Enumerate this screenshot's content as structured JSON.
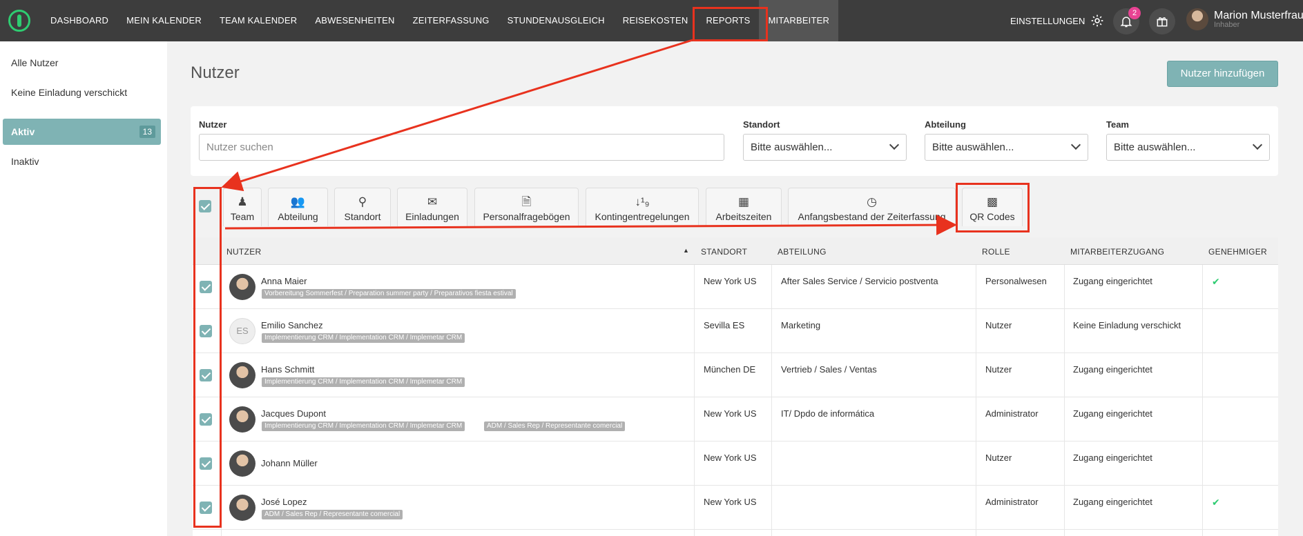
{
  "nav": {
    "items": [
      "DASHBOARD",
      "MEIN KALENDER",
      "TEAM KALENDER",
      "ABWESENHEITEN",
      "ZEITERFASSUNG",
      "STUNDENAUSGLEICH",
      "REISEKOSTEN",
      "REPORTS",
      "MITARBEITER"
    ],
    "settings_label": "EINSTELLUNGEN",
    "notification_count": "2",
    "user_name": "Marion Musterfrau",
    "user_role": "Inhaber"
  },
  "sidebar": {
    "items": [
      {
        "label": "Alle Nutzer"
      },
      {
        "label": "Keine Einladung verschickt"
      },
      {
        "label": "Aktiv",
        "count": "13"
      },
      {
        "label": "Inaktiv"
      }
    ]
  },
  "page": {
    "title": "Nutzer",
    "add_button": "Nutzer hinzufügen"
  },
  "filters": {
    "user_label": "Nutzer",
    "user_placeholder": "Nutzer suchen",
    "location_label": "Standort",
    "department_label": "Abteilung",
    "team_label": "Team",
    "select_value": "Bitte auswählen..."
  },
  "toolbar": {
    "tabs": [
      "Team",
      "Abteilung",
      "Standort",
      "Einladungen",
      "Personalfragebögen",
      "Kontingentregelungen",
      "Arbeitszeiten",
      "Anfangsbestand der Zeiterfassung",
      "QR Codes"
    ]
  },
  "table": {
    "headers": [
      "NUTZER",
      "STANDORT",
      "ABTEILUNG",
      "ROLLE",
      "MITARBEITERZUGANG",
      "GENEHMIGER"
    ],
    "rows": [
      {
        "name": "Anna Maier",
        "tags": [
          "Vorbereitung Sommerfest / Preparation summer party / Preparativos fiesta estival"
        ],
        "location": "New York US",
        "department": "After Sales Service / Servicio postventa",
        "role": "Personalwesen",
        "access": "Zugang eingerichtet",
        "approver": "✔"
      },
      {
        "name": "Emilio Sanchez",
        "initials": "ES",
        "tags": [
          "Implementierung CRM / Implementation CRM / Implemetar CRM"
        ],
        "location": "Sevilla ES",
        "department": "Marketing",
        "role": "Nutzer",
        "access": "Keine Einladung verschickt",
        "approver": ""
      },
      {
        "name": "Hans Schmitt",
        "tags": [
          "Implementierung CRM / Implementation CRM / Implemetar CRM"
        ],
        "location": "München DE",
        "department": "Vertrieb / Sales / Ventas",
        "role": "Nutzer",
        "access": "Zugang eingerichtet",
        "approver": ""
      },
      {
        "name": "Jacques Dupont",
        "tags": [
          "Implementierung CRM / Implementation CRM / Implemetar CRM",
          "ADM / Sales Rep / Representante comercial"
        ],
        "location": "New York US",
        "department": "IT/ Dpdo de informática",
        "role": "Administrator",
        "access": "Zugang eingerichtet",
        "approver": ""
      },
      {
        "name": "Johann Müller",
        "tags": [],
        "location": "New York US",
        "department": "",
        "role": "Nutzer",
        "access": "Zugang eingerichtet",
        "approver": ""
      },
      {
        "name": "José Lopez",
        "tags": [
          "ADM / Sales Rep / Representante comercial"
        ],
        "location": "New York US",
        "department": "",
        "role": "Administrator",
        "access": "Zugang eingerichtet",
        "approver": "✔"
      }
    ]
  },
  "colors": {
    "accent": "#7fb3b4",
    "topbar": "#3d3d3d",
    "annotation": "#e8321e",
    "badge": "#e84393"
  }
}
